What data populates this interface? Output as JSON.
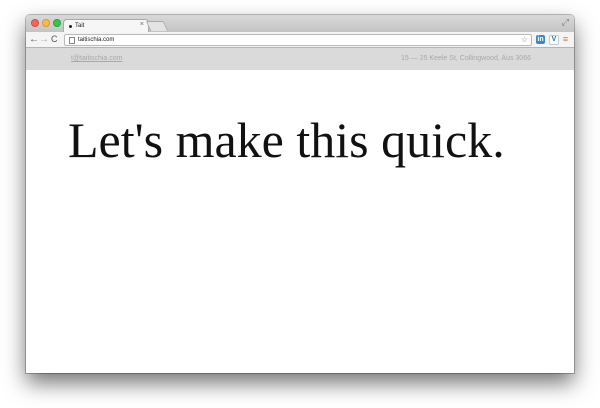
{
  "browser": {
    "tab_title": "Tait",
    "tab_close": "×",
    "url": "taitischia.com",
    "icons": {
      "back": "←",
      "forward": "→",
      "reload": "C",
      "star": "☆",
      "menu": "≡",
      "fullscreen": "⤢"
    },
    "extensions": [
      {
        "name": "extension-icon-blue",
        "glyph": "in"
      },
      {
        "name": "extension-icon-v",
        "glyph": "V"
      }
    ]
  },
  "page": {
    "email": "t@taitischia.com",
    "address": "15 — 25 Keele St, Collingwood, Aus 3066",
    "headline": "Let's make this quick."
  }
}
